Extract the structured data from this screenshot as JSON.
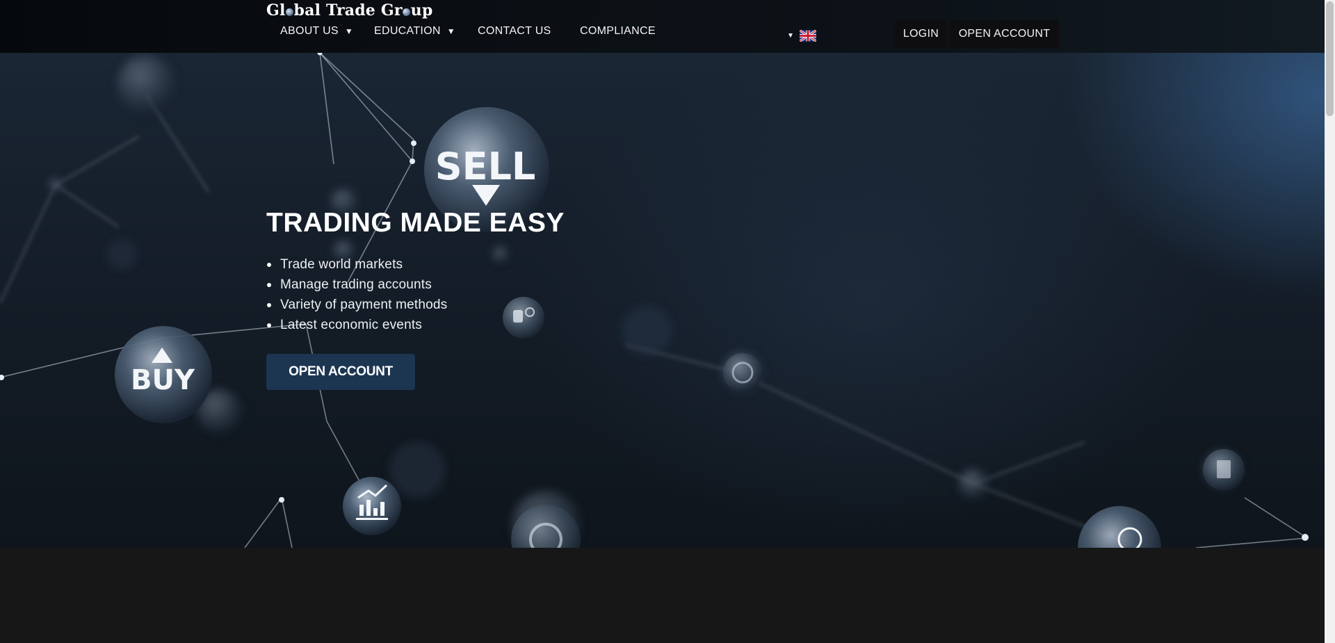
{
  "brand": {
    "logo_part1": "Gl",
    "logo_part2": "bal Trade Gr",
    "logo_part3": "up"
  },
  "nav": {
    "items": [
      {
        "label": "ABOUT US",
        "has_dropdown": true
      },
      {
        "label": "EDUCATION",
        "has_dropdown": true
      },
      {
        "label": "CONTACT US",
        "has_dropdown": false
      },
      {
        "label": "COMPLIANCE",
        "has_dropdown": false
      }
    ],
    "dropdown_caret": "▼",
    "language": {
      "flag_icon": "uk-flag-icon",
      "caret": "▼"
    },
    "login_label": "LOGIN",
    "open_account_label": "OPEN ACCOUNT"
  },
  "hero": {
    "title": "TRADING MADE EASY",
    "features": [
      "Trade world markets",
      "Manage trading accounts",
      "Variety of payment methods",
      "Latest economic events"
    ],
    "cta_label": "OPEN ACCOUNT",
    "orb_labels": {
      "sell": "SELL",
      "buy": "BUY"
    }
  },
  "colors": {
    "cta_bg": "#1c3652",
    "header_bg": "#0b0f14",
    "footer_bg": "#171717"
  }
}
